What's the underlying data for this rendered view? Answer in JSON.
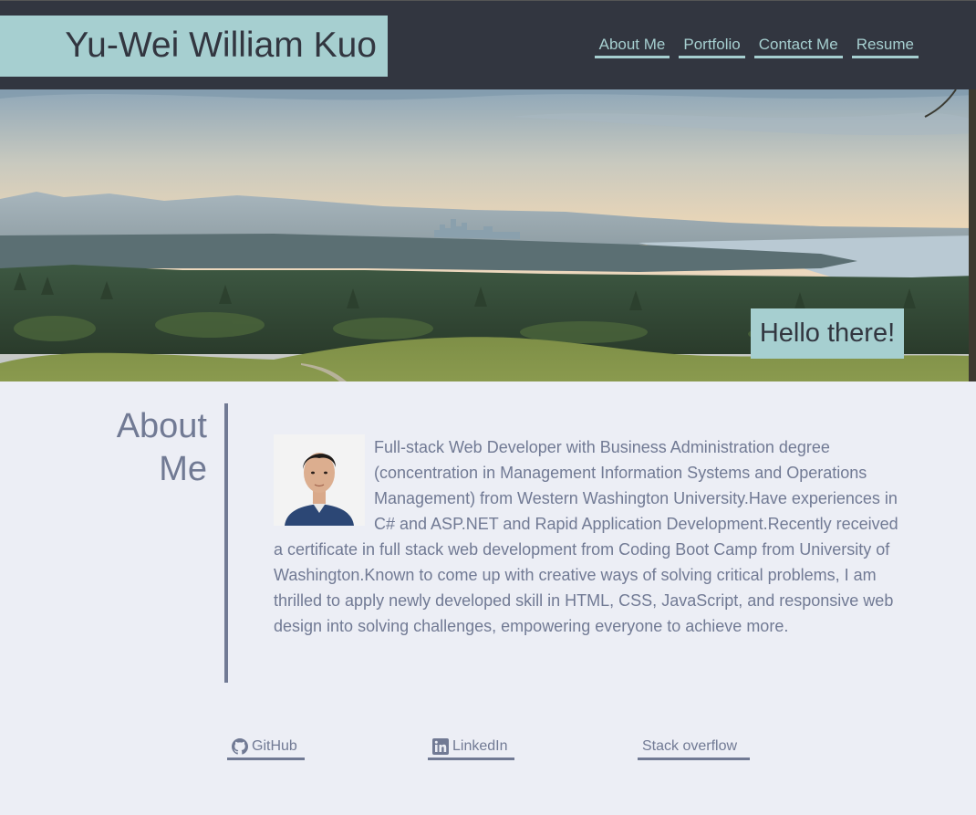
{
  "header": {
    "brand": "Yu-Wei William Kuo",
    "nav": [
      {
        "label": "About Me"
      },
      {
        "label": "Portfolio"
      },
      {
        "label": "Contact Me"
      },
      {
        "label": "Resume"
      }
    ]
  },
  "hero": {
    "greeting": "Hello there!"
  },
  "about": {
    "title_line1": "About",
    "title_line2": "Me",
    "bio": "Full-stack Web Developer with Business Administration degree (concentration in Management Information Systems and Operations Management) from Western Washington University.Have experiences in C# and ASP.NET and Rapid Application Development.Recently received a certificate in full stack web development from Coding Boot Camp from University of Washington.Known to come up with creative ways of solving critical problems, I am thrilled to apply newly developed skill in HTML, CSS, JavaScript, and responsive web design into solving challenges, empowering everyone to achieve more."
  },
  "links": [
    {
      "label": "GitHub",
      "icon": "github-icon"
    },
    {
      "label": "LinkedIn",
      "icon": "linkedin-icon"
    },
    {
      "label": "Stack overflow",
      "icon": ""
    }
  ],
  "colors": {
    "header_bg": "#323640",
    "accent": "#a6cfd0",
    "page_bg": "#eceef5",
    "text_muted": "#717a94"
  }
}
